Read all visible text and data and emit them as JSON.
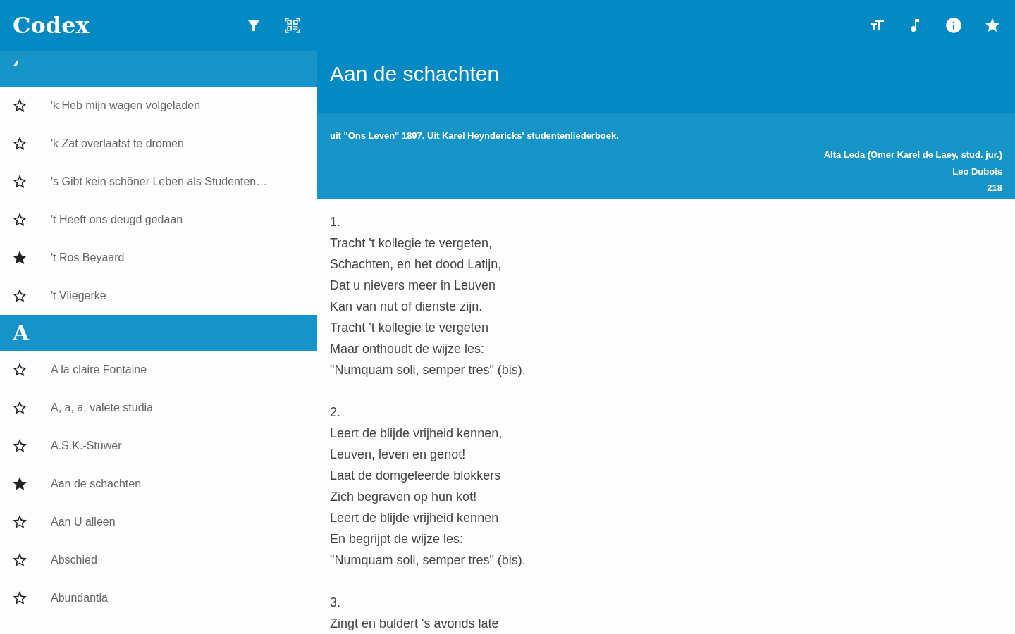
{
  "app_bar": {
    "logo": "Codex"
  },
  "sections": [
    {
      "letter": "’",
      "songs": [
        {
          "title": "'k Heb mijn wagen volgeladen",
          "favorite": false
        },
        {
          "title": "'k Zat overlaatst te dromen",
          "favorite": false
        },
        {
          "title": "'s Gibt kein schöner Leben als Studenten…",
          "favorite": false
        },
        {
          "title": "'t Heeft ons deugd gedaan",
          "favorite": false
        },
        {
          "title": "'t Ros Beyaard",
          "favorite": true
        },
        {
          "title": "'t Vliegerke",
          "favorite": false
        }
      ]
    },
    {
      "letter": "A",
      "songs": [
        {
          "title": "A la claire Fontaine",
          "favorite": false
        },
        {
          "title": "A, a, a, valete studia",
          "favorite": false
        },
        {
          "title": "A.S.K.-Stuwer",
          "favorite": false
        },
        {
          "title": "Aan de schachten",
          "favorite": true
        },
        {
          "title": "Aan U alleen",
          "favorite": false
        },
        {
          "title": "Abschied",
          "favorite": false
        },
        {
          "title": "Abundantia",
          "favorite": false
        }
      ]
    }
  ],
  "song": {
    "title": "Aan de schachten",
    "favorite": true,
    "source": "uit \"Ons Leven\" 1897. Uit Karel Heyndericks' studentenliederboek.",
    "lyricist": "Alta Leda (Omer Karel de Laey, stud. jur.)",
    "composer": "Leo Dubois",
    "number": "218",
    "verses": [
      {
        "number": "1.",
        "lines": [
          "Tracht 't kollegie te vergeten,",
          "Schachten, en het dood Latijn,",
          "Dat u nievers meer in Leuven",
          "Kan van nut of dienste zijn.",
          "Tracht 't kollegie te vergeten",
          "Maar onthoudt de wijze les:",
          "\"Numquam soli, semper tres\" (bis)."
        ]
      },
      {
        "number": "2.",
        "lines": [
          "Leert de blijde vrijheid kennen,",
          "Leuven, leven en genot!",
          "Laat de domgeleerde blokkers",
          "Zich begraven op hun kot!",
          "Leert de blijde vrijheid kennen",
          "En begrijpt de wijze les:",
          "\"Numquam soli, semper tres\" (bis)."
        ]
      },
      {
        "number": "3.",
        "lines": [
          "Zingt en buldert 's avonds late"
        ]
      }
    ]
  }
}
